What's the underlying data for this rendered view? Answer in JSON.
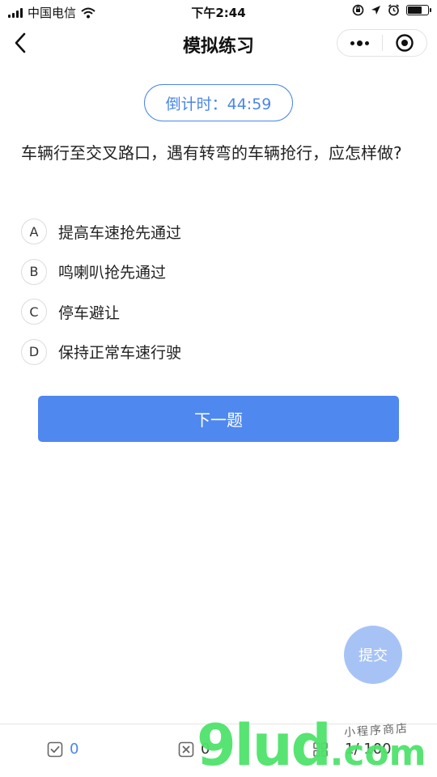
{
  "status_bar": {
    "carrier": "中国电信",
    "time": "下午2:44",
    "battery_level": 0.7
  },
  "nav": {
    "title": "模拟练习"
  },
  "countdown": {
    "label": "倒计时：44:59"
  },
  "question": {
    "text": "车辆行至交叉路口，遇有转弯的车辆抢行，应怎样做?"
  },
  "options": [
    {
      "letter": "A",
      "text": "提高车速抢先通过"
    },
    {
      "letter": "B",
      "text": "鸣喇叭抢先通过"
    },
    {
      "letter": "C",
      "text": "停车避让"
    },
    {
      "letter": "D",
      "text": "保持正常车速行驶"
    }
  ],
  "next_button": {
    "label": "下一题"
  },
  "submit_button": {
    "label": "提交"
  },
  "bottom_bar": {
    "correct_count": "0",
    "wrong_count": "0",
    "progress": "1/ 100"
  },
  "watermark": {
    "main": "9lud",
    "suffix": ".com",
    "tagline": "小程序商店"
  },
  "colors": {
    "accent": "#4a86e8",
    "next_button": "#4f88ee",
    "submit_button": "#a7c3f6",
    "watermark": "#4fe36b"
  }
}
